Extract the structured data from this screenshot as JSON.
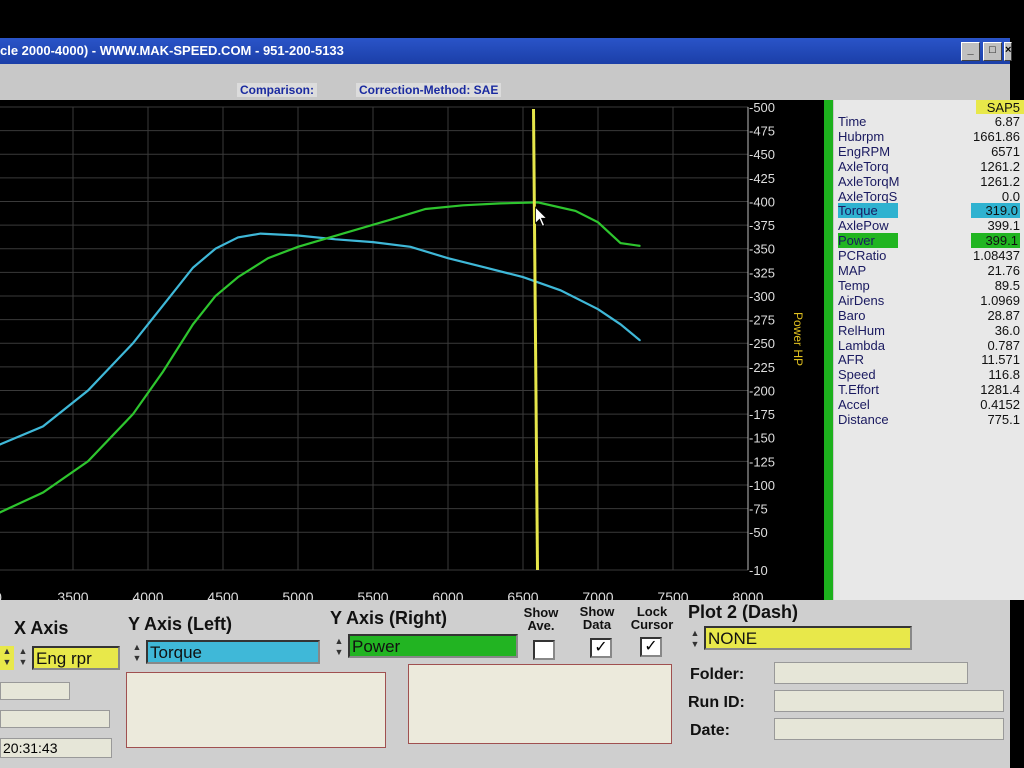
{
  "window": {
    "title": "cle 2000-4000) - WWW.MAK-SPEED.COM - 951-200-5133",
    "buttons": [
      "_",
      "□",
      "×"
    ]
  },
  "subheader": {
    "comparison": "Comparison:",
    "correction": "Correction-Method: SAE"
  },
  "chart_data": {
    "type": "line",
    "xlabel": "",
    "ylabel_right": "Power HP",
    "xlim": [
      3000,
      8000
    ],
    "ylim_right": [
      10,
      500
    ],
    "x_ticks": [
      "0",
      "3500",
      "4000",
      "4500",
      "5000",
      "5500",
      "6000",
      "6500",
      "7000",
      "7500",
      "8000"
    ],
    "y_ticks_right": [
      "-500",
      "-475",
      "-450",
      "-425",
      "-400",
      "-375",
      "-350",
      "-325",
      "-300",
      "-275",
      "-250",
      "-225",
      "-200",
      "-175",
      "-150",
      "-125",
      "-100",
      "-75",
      "-50",
      "-10"
    ],
    "cursor_x": 6570,
    "series": [
      {
        "name": "Torque",
        "color": "#3fb8d8",
        "x": [
          3000,
          3300,
          3600,
          3900,
          4100,
          4300,
          4450,
          4600,
          4750,
          5000,
          5250,
          5500,
          5750,
          6000,
          6250,
          6500,
          6750,
          7000,
          7150,
          7280
        ],
        "y": [
          142,
          162,
          200,
          250,
          290,
          330,
          350,
          362,
          366,
          364,
          360,
          357,
          352,
          340,
          330,
          320,
          306,
          286,
          270,
          253
        ]
      },
      {
        "name": "Power",
        "color": "#2ec52e",
        "x": [
          3000,
          3300,
          3600,
          3900,
          4100,
          4300,
          4450,
          4600,
          4800,
          5000,
          5300,
          5600,
          5850,
          6100,
          6350,
          6600,
          6850,
          7000,
          7150,
          7280
        ],
        "y": [
          70,
          92,
          125,
          175,
          220,
          270,
          300,
          320,
          340,
          352,
          366,
          380,
          392,
          396,
          398,
          399,
          390,
          378,
          356,
          353
        ]
      }
    ]
  },
  "panel": {
    "sap_label": "SAP5",
    "rows": [
      {
        "label": "Time",
        "value": "6.87"
      },
      {
        "label": "Hubrpm",
        "value": "1661.86"
      },
      {
        "label": "EngRPM",
        "value": "6571"
      },
      {
        "label": "AxleTorq",
        "value": "1261.2"
      },
      {
        "label": "AxleTorqM",
        "value": "1261.2"
      },
      {
        "label": "AxleTorqS",
        "value": "0.0"
      },
      {
        "label": "Torque",
        "value": "319.0"
      },
      {
        "label": "AxlePow",
        "value": "399.1"
      },
      {
        "label": "Power",
        "value": "399.1"
      },
      {
        "label": "PCRatio",
        "value": "1.08437"
      },
      {
        "label": "MAP",
        "value": "21.76"
      },
      {
        "label": "Temp",
        "value": "89.5"
      },
      {
        "label": "AirDens",
        "value": "1.0969"
      },
      {
        "label": "Baro",
        "value": "28.87"
      },
      {
        "label": "RelHum",
        "value": "36.0"
      },
      {
        "label": "Lambda",
        "value": "0.787"
      },
      {
        "label": "AFR",
        "value": "11.571"
      },
      {
        "label": "Speed",
        "value": "116.8"
      },
      {
        "label": "T.Effort",
        "value": "1281.4"
      },
      {
        "label": "Accel",
        "value": "0.4152"
      },
      {
        "label": "Distance",
        "value": "775.1"
      }
    ]
  },
  "controls": {
    "x_axis_label": "X Axis",
    "x_axis_value": "Eng rpr",
    "y_left_label": "Y Axis (Left)",
    "y_left_value": "Torque",
    "y_right_label": "Y Axis (Right)",
    "y_right_value": "Power",
    "show_ave_label": "Show Ave.",
    "show_data_label": "Show Data",
    "lock_cursor_label": "Lock Cursor",
    "plot2_label": "Plot 2 (Dash)",
    "plot2_value": "NONE",
    "folder_label": "Folder:",
    "runid_label": "Run ID:",
    "date_label": "Date:",
    "time_value": "20:31:43",
    "show_ave_checked": false,
    "show_data_checked": true,
    "lock_cursor_checked": true
  },
  "colors": {
    "torque": "#3fb8d8",
    "power": "#2ec52e",
    "cursor": "#e6e64a",
    "titlebar": "#1b3fa8"
  }
}
